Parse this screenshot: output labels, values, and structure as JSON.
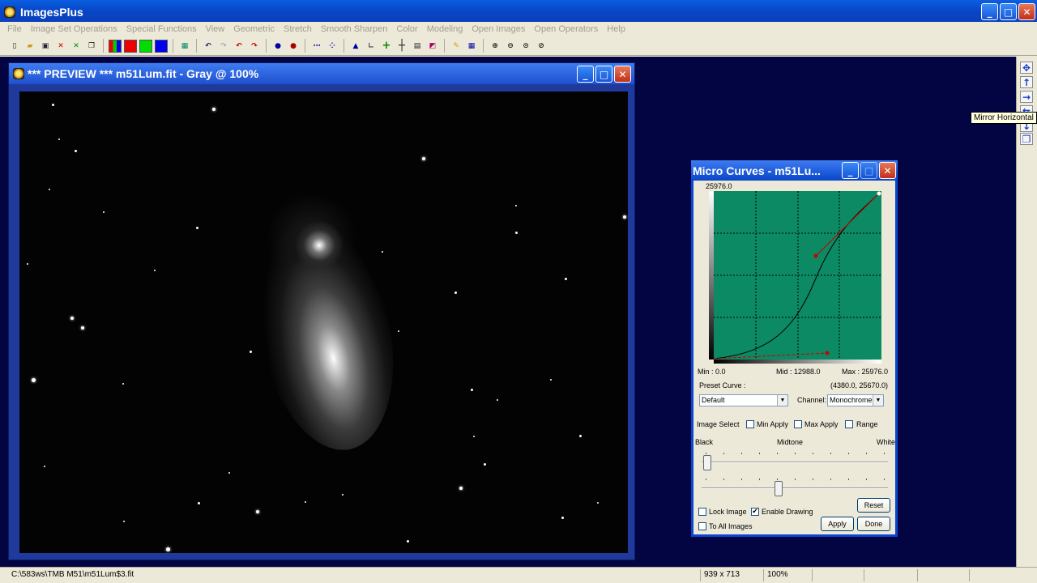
{
  "app": {
    "title": "ImagesPlus",
    "close_glyph": "✕"
  },
  "menu": [
    "File",
    "Image Set Operations",
    "Special Functions",
    "View",
    "Geometric",
    "Stretch",
    "Smooth Sharpen",
    "Color",
    "Modeling",
    "Open Images",
    "Open Operators",
    "Help"
  ],
  "toolbar": {
    "icons": [
      "new-file-icon",
      "open-folder-icon",
      "save-icon",
      "close-red-x-icon",
      "close-green-x-icon",
      "copy-icon",
      "rgb-channels-icon",
      "red-channel-icon",
      "green-channel-icon",
      "blue-channel-icon",
      "grid-icon",
      "undo-icon",
      "redo-icon",
      "undo-red-icon",
      "redo-red-icon",
      "ellipse-select-icon",
      "circle-select-icon",
      "dots-icon",
      "points-icon",
      "histogram-icon",
      "axis-icon",
      "plus-green-icon",
      "crosshair-icon",
      "calculator-icon",
      "image-edit-icon",
      "pencil-icon",
      "table-icon",
      "zoom-in-icon",
      "zoom-out-icon",
      "zoom-fit-icon",
      "zoom-reset-icon"
    ]
  },
  "preview": {
    "title": "*** PREVIEW *** m51Lum.fit - Gray @ 100%"
  },
  "micro_curves": {
    "title": "Micro Curves - m51Lu...",
    "max_value_label": "25976.0",
    "min_label": "Min :  0.0",
    "mid_label": "Mid :  12988.0",
    "max_label": "Max :  25976.0",
    "preset_curve_label": "Preset Curve :",
    "coordinate": "(4380.0, 25670.0)",
    "preset_value": "Default",
    "channel_label": "Channel:",
    "channel_value": "Monochrome",
    "image_select_label": "Image Select",
    "min_apply": "Min Apply",
    "max_apply": "Max Apply",
    "range": "Range",
    "black_label": "Black",
    "midtone_label": "Midtone",
    "white_label": "White",
    "lock_image": "Lock Image",
    "enable_drawing": "Enable Drawing",
    "to_all_images": "To All Images",
    "reset_button": "Reset",
    "apply_button": "Apply",
    "done_button": "Done",
    "enable_drawing_checked": "✔",
    "plot_background": "#0b8a63"
  },
  "right_toolbar": {
    "icons": [
      "move-cross-icon",
      "arrow-up-icon",
      "arrow-right-icon",
      "mirror-horizontal-icon",
      "arrow-down-icon",
      "copy-small-icon"
    ]
  },
  "tooltip": "Mirror Horizontal",
  "statusbar": {
    "path": "C:\\583ws\\TMB M51\\m51Lum$3.fit",
    "dimensions": "939 x 713",
    "zoom": "100%"
  }
}
